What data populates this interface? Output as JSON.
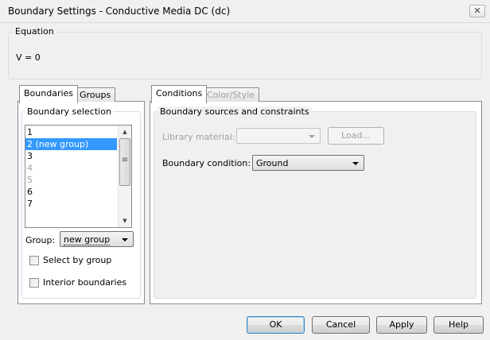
{
  "window": {
    "title": "Boundary Settings - Conductive Media DC (dc)",
    "close_glyph": "✕"
  },
  "equation": {
    "legend": "Equation",
    "text": "V = 0"
  },
  "left_tabs": [
    "Boundaries",
    "Groups"
  ],
  "boundary_selection": {
    "legend": "Boundary selection",
    "items": [
      {
        "label": "1",
        "state": "normal"
      },
      {
        "label": "2 (new group)",
        "state": "selected"
      },
      {
        "label": "3",
        "state": "normal"
      },
      {
        "label": "4",
        "state": "disabled"
      },
      {
        "label": "5",
        "state": "disabled"
      },
      {
        "label": "6",
        "state": "normal"
      },
      {
        "label": "7",
        "state": "normal"
      }
    ],
    "scroll_up_glyph": "▲",
    "scroll_down_glyph": "▼",
    "scroll_grip_glyph": "≡"
  },
  "group": {
    "label": "Group:",
    "value": "new group"
  },
  "checkboxes": {
    "select_by_group": "Select by group",
    "interior_boundaries": "Interior boundaries"
  },
  "right_tabs": [
    "Conditions",
    "Color/Style"
  ],
  "conditions": {
    "legend": "Boundary sources and constraints",
    "library_material_label": "Library material:",
    "library_material_value": "",
    "load_button": "Load...",
    "boundary_condition_label": "Boundary condition:",
    "boundary_condition_value": "Ground"
  },
  "buttons": {
    "ok": "OK",
    "cancel": "Cancel",
    "apply": "Apply",
    "help": "Help"
  },
  "colors": {
    "selection": "#3399ff",
    "background": "#f0f0f0",
    "default_button_border": "#3c7fb1"
  }
}
